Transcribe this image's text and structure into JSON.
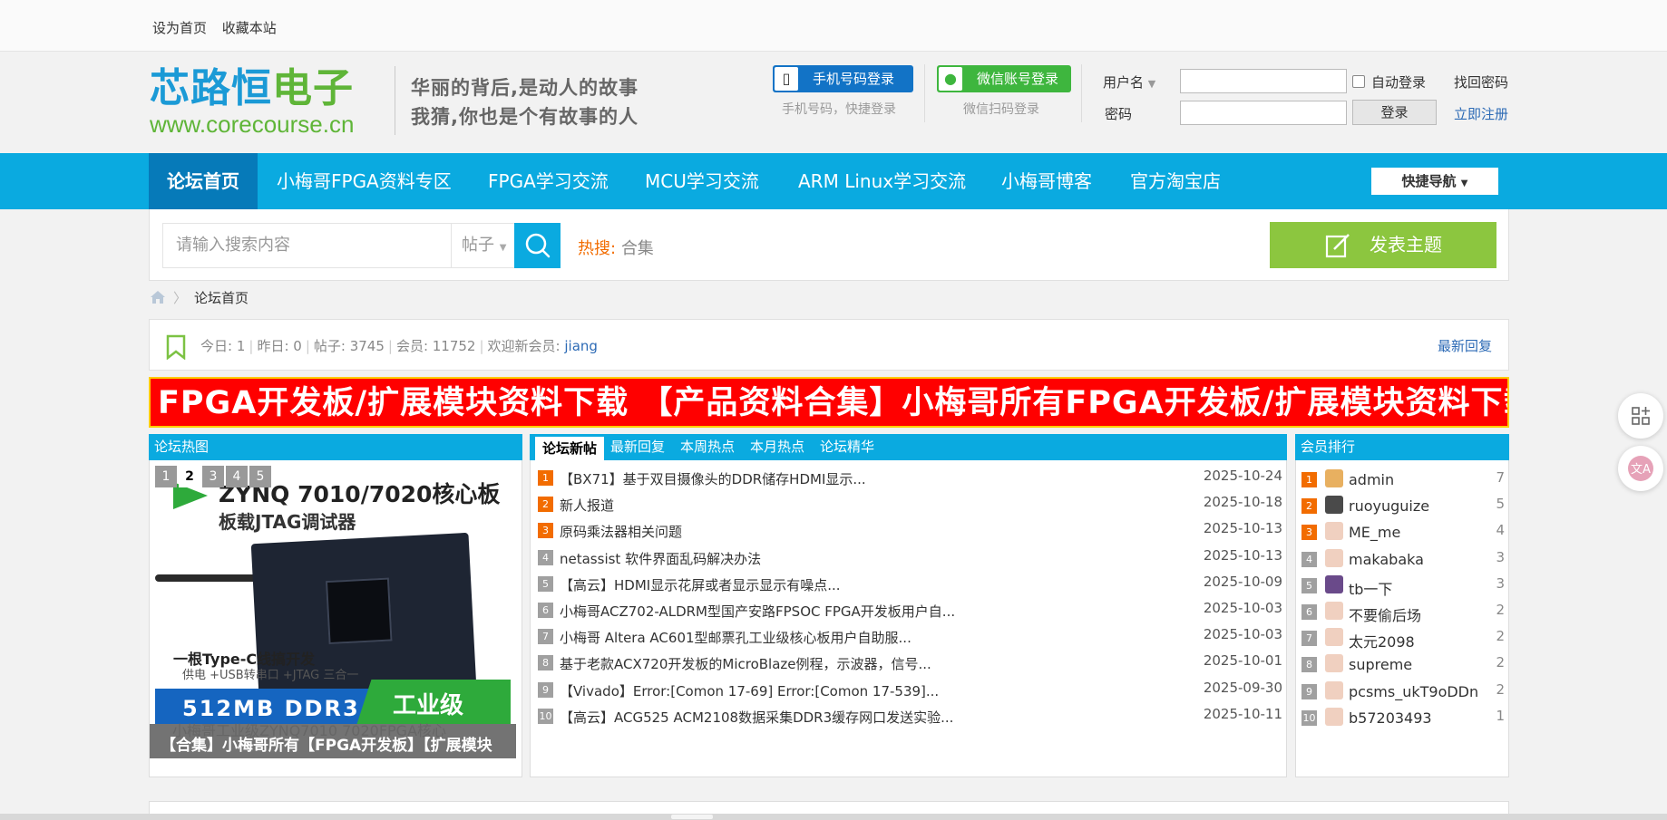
{
  "topbar": {
    "set_home": "设为首页",
    "bookmark": "收藏本站"
  },
  "logo": {
    "cn_part1": "芯路恒",
    "cn_part2": "电子",
    "url": "www.corecourse.cn"
  },
  "slogan": {
    "line1": "华丽的背后,是动人的故事",
    "line2": "我猜,你也是个有故事的人"
  },
  "login": {
    "phone_btn": "手机号码登录",
    "phone_sub": "手机号码，快捷登录",
    "wechat_btn": "微信账号登录",
    "wechat_sub": "微信扫码登录",
    "username_label": "用户名",
    "password_label": "密码",
    "auto_login": "自动登录",
    "submit": "登录",
    "forgot": "找回密码",
    "register": "立即注册"
  },
  "nav": {
    "items": [
      "论坛首页",
      "小梅哥FPGA资料专区",
      "FPGA学习交流",
      "MCU学习交流",
      "ARM Linux学习交流",
      "小梅哥博客",
      "官方淘宝店"
    ],
    "quick": "快捷导航"
  },
  "search": {
    "placeholder": "请输入搜索内容",
    "type": "帖子",
    "hot_label": "热搜:",
    "hot_term": "合集",
    "post_btn": "发表主题"
  },
  "breadcrumb": {
    "current": "论坛首页"
  },
  "stats": {
    "today": "今日: 1",
    "yesterday": "昨日: 0",
    "posts": "帖子: 3745",
    "members": "会员: 11752",
    "welcome": "欢迎新会员:",
    "new_member": "jiang",
    "latest_reply": "最新回复"
  },
  "banner": {
    "text": "FPGA开发板/扩展模块资料下载    【产品资料合集】小梅哥所有FPGA开发板/扩展模块资料下载"
  },
  "hot_panel": {
    "title": "论坛热图",
    "pager": [
      "1",
      "2",
      "3",
      "4",
      "5"
    ],
    "active_page": "2",
    "image_title": "ZYNQ 7010/7020核心板",
    "image_sub": "板载JTAG调试器",
    "image_line1": "一根Type-C线搞开发",
    "image_line2": "供电 +USB转串口 +JTAG 三合一",
    "image_ddr": "512MB DDR3",
    "image_ind": "工业级",
    "caption_back": "小梅哥工业级ZYNQ7010 7020FPGA核心",
    "caption": "【合集】小梅哥所有【FPGA开发板】【扩展模块"
  },
  "tabs": [
    "论坛新帖",
    "最新回复",
    "本周热点",
    "本月热点",
    "论坛精华"
  ],
  "posts": [
    {
      "n": "1",
      "title": "【BX71】基于双目摄像头的DDR储存HDMI显示...",
      "date": "2025-10-24"
    },
    {
      "n": "2",
      "title": "新人报道",
      "date": "2025-10-18"
    },
    {
      "n": "3",
      "title": "原码乘法器相关问题",
      "date": "2025-10-13"
    },
    {
      "n": "4",
      "title": "netassist 软件界面乱码解决办法",
      "date": "2025-10-13"
    },
    {
      "n": "5",
      "title": "【高云】HDMI显示花屏或者显示显示有噪点...",
      "date": "2025-10-09"
    },
    {
      "n": "6",
      "title": "小梅哥ACZ702-ALDRM型国产安路FPSOC FPGA开发板用户自...",
      "date": "2025-10-03"
    },
    {
      "n": "7",
      "title": "小梅哥 Altera AC601型邮票孔工业级核心板用户自助服...",
      "date": "2025-10-03"
    },
    {
      "n": "8",
      "title": "基于老款ACX720开发板的MicroBlaze例程，示波器，信号...",
      "date": "2025-10-01"
    },
    {
      "n": "9",
      "title": "【Vivado】Error:[Comon 17-69] Error:[Comon 17-539]...",
      "date": "2025-09-30"
    },
    {
      "n": "10",
      "title": "【高云】ACG525 ACM2108数据采集DDR3缓存网口发送实验...",
      "date": "2025-10-11"
    }
  ],
  "members_panel": {
    "title": "会员排行",
    "items": [
      {
        "n": "1",
        "name": "admin",
        "count": "7"
      },
      {
        "n": "2",
        "name": "ruoyuguize",
        "count": "5"
      },
      {
        "n": "3",
        "name": "ME_me",
        "count": "4"
      },
      {
        "n": "4",
        "name": "makabaka",
        "count": "3"
      },
      {
        "n": "5",
        "name": "tb一下",
        "count": "3"
      },
      {
        "n": "6",
        "name": "不要偷后场",
        "count": "2"
      },
      {
        "n": "7",
        "name": "太元2098",
        "count": "2"
      },
      {
        "n": "8",
        "name": "supreme",
        "count": "2"
      },
      {
        "n": "9",
        "name": "pcsms_ukT9oDDn",
        "count": "2"
      },
      {
        "n": "10",
        "name": "b57203493",
        "count": "1"
      }
    ]
  },
  "colors": {
    "nav": "#0aaae0",
    "nav_active": "#067ab9",
    "hot_num": "#f26c00",
    "post_btn": "#8cc63f",
    "banner": "#ff0000"
  },
  "icons": [
    "home-icon",
    "search-icon",
    "edit-icon",
    "bookmark-icon",
    "phone-icon",
    "wechat-icon",
    "add-app-icon",
    "translate-icon"
  ]
}
